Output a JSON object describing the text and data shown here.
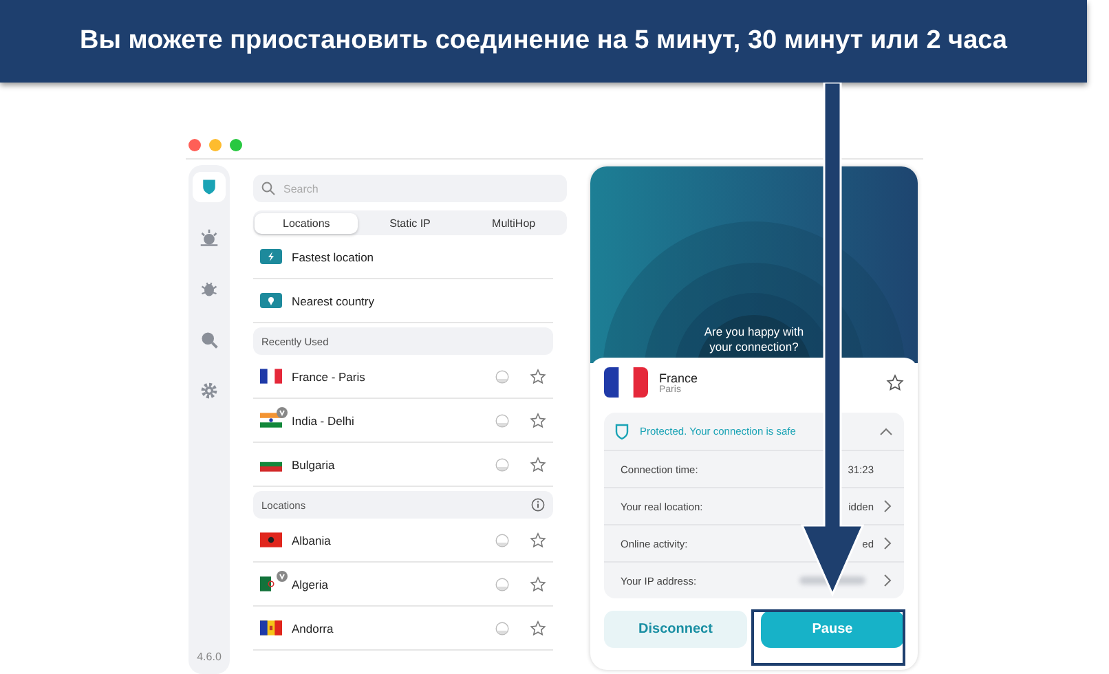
{
  "banner": {
    "text": "Вы можете приостановить соединение на 5 минут, 30 минут или 2 часа"
  },
  "sidebar": {
    "items": [
      {
        "selected": true
      },
      {
        "selected": false
      },
      {
        "selected": false
      },
      {
        "selected": false
      },
      {
        "selected": false
      }
    ],
    "version": "4.6.0"
  },
  "search": {
    "placeholder": "Search"
  },
  "tabs": [
    {
      "label": "Locations",
      "selected": true
    },
    {
      "label": "Static IP",
      "selected": false
    },
    {
      "label": "MultiHop",
      "selected": false
    }
  ],
  "quick": [
    {
      "kind": "fastest",
      "label": "Fastest location"
    },
    {
      "kind": "nearest",
      "label": "Nearest country"
    }
  ],
  "sections": [
    {
      "title": "Recently Used",
      "info": false,
      "rows": [
        {
          "name": "France - Paris",
          "kind": "france",
          "virtual": false
        },
        {
          "name": "India - Delhi",
          "kind": "india",
          "virtual": true
        },
        {
          "name": "Bulgaria",
          "kind": "bulgaria",
          "virtual": false
        }
      ]
    },
    {
      "title": "Locations",
      "info": true,
      "rows": [
        {
          "name": "Albania",
          "kind": "albania",
          "virtual": false
        },
        {
          "name": "Algeria",
          "kind": "algeria",
          "virtual": true
        },
        {
          "name": "Andorra",
          "kind": "andorra",
          "virtual": false
        }
      ]
    }
  ],
  "connection": {
    "question": "Are you happy with your connection?",
    "country": "France",
    "city": "Paris",
    "kind": "france",
    "status": "Protected. Your connection is safe",
    "expanded": true,
    "details": [
      {
        "label": "Connection time:",
        "value": "31:23",
        "link": false,
        "blurred": false
      },
      {
        "label": "Your real location:",
        "value": "idden",
        "link": true,
        "blurred": false
      },
      {
        "label": "Online activity:",
        "value": "ed",
        "link": true,
        "blurred": false
      },
      {
        "label": "Your IP address:",
        "link": true,
        "blurred": true
      }
    ],
    "buttons": [
      {
        "label": "Disconnect",
        "kind": "secondary"
      },
      {
        "label": "Pause",
        "kind": "primary",
        "highlighted": true
      }
    ]
  }
}
